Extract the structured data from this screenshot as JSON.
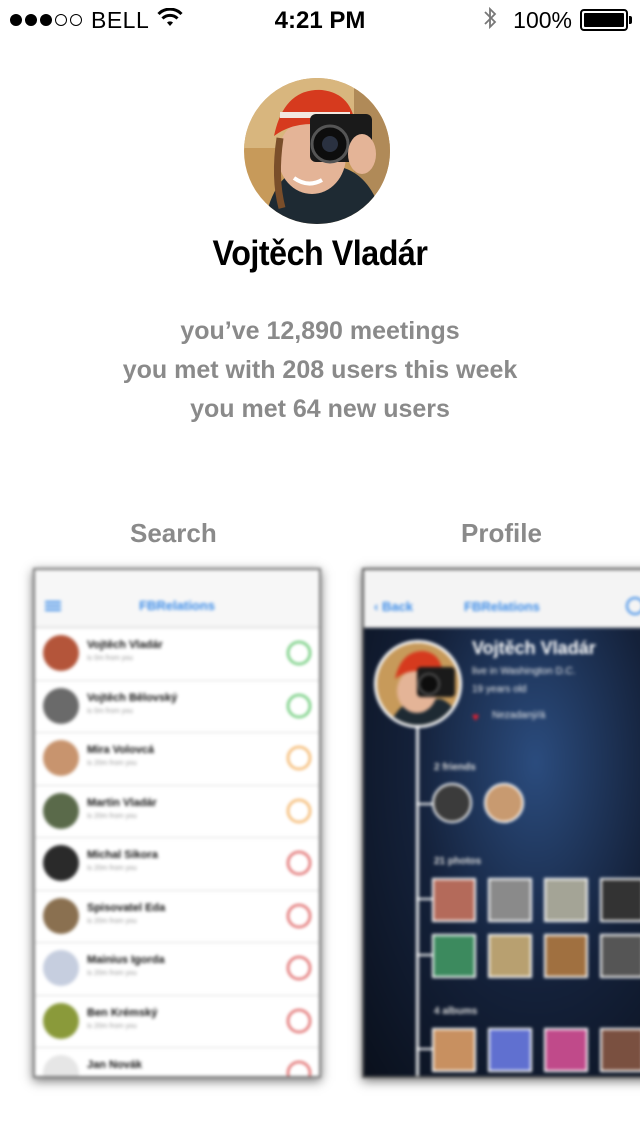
{
  "status_bar": {
    "carrier": "BELL",
    "time": "4:21 PM",
    "battery_percent": "100%"
  },
  "profile": {
    "name": "Vojtěch Vladár",
    "stats": [
      "you’ve 12,890 meetings",
      "you met with 208 users this week",
      "you met 64 new users"
    ]
  },
  "previews": {
    "search_label": "Search",
    "profile_label": "Profile"
  },
  "search_preview": {
    "title": "FBRelations",
    "rows": [
      {
        "name": "Vojtěch Vladár",
        "sub": "is 0m from you"
      },
      {
        "name": "Vojtěch Bělovský",
        "sub": "is 0m from you"
      },
      {
        "name": "Mira Volovcá",
        "sub": "is 20m from you"
      },
      {
        "name": "Martin Vladár",
        "sub": "is 20m from you"
      },
      {
        "name": "Michal Sikora",
        "sub": "is 20m from you"
      },
      {
        "name": "Spisovatel Eda",
        "sub": "is 20m from you"
      },
      {
        "name": "Mainius Igorda",
        "sub": "is 20m from you"
      },
      {
        "name": "Ben Krémský",
        "sub": "is 20m from you"
      },
      {
        "name": "Jan Novák",
        "sub": ""
      }
    ]
  },
  "profile_preview": {
    "back_label": "Back",
    "title": "FBRelations",
    "name": "Vojtěch Vladár",
    "location": "live in Washington D.C.",
    "age": "19 years old",
    "relationship": "Nezadaný/á",
    "friends_label": "2 friends",
    "photos_label": "21 photos",
    "albums_label": "4 albums"
  },
  "colors": {
    "accent": "#3a8be8",
    "stats_gray": "#8a8a8a",
    "heart": "#e02030"
  }
}
